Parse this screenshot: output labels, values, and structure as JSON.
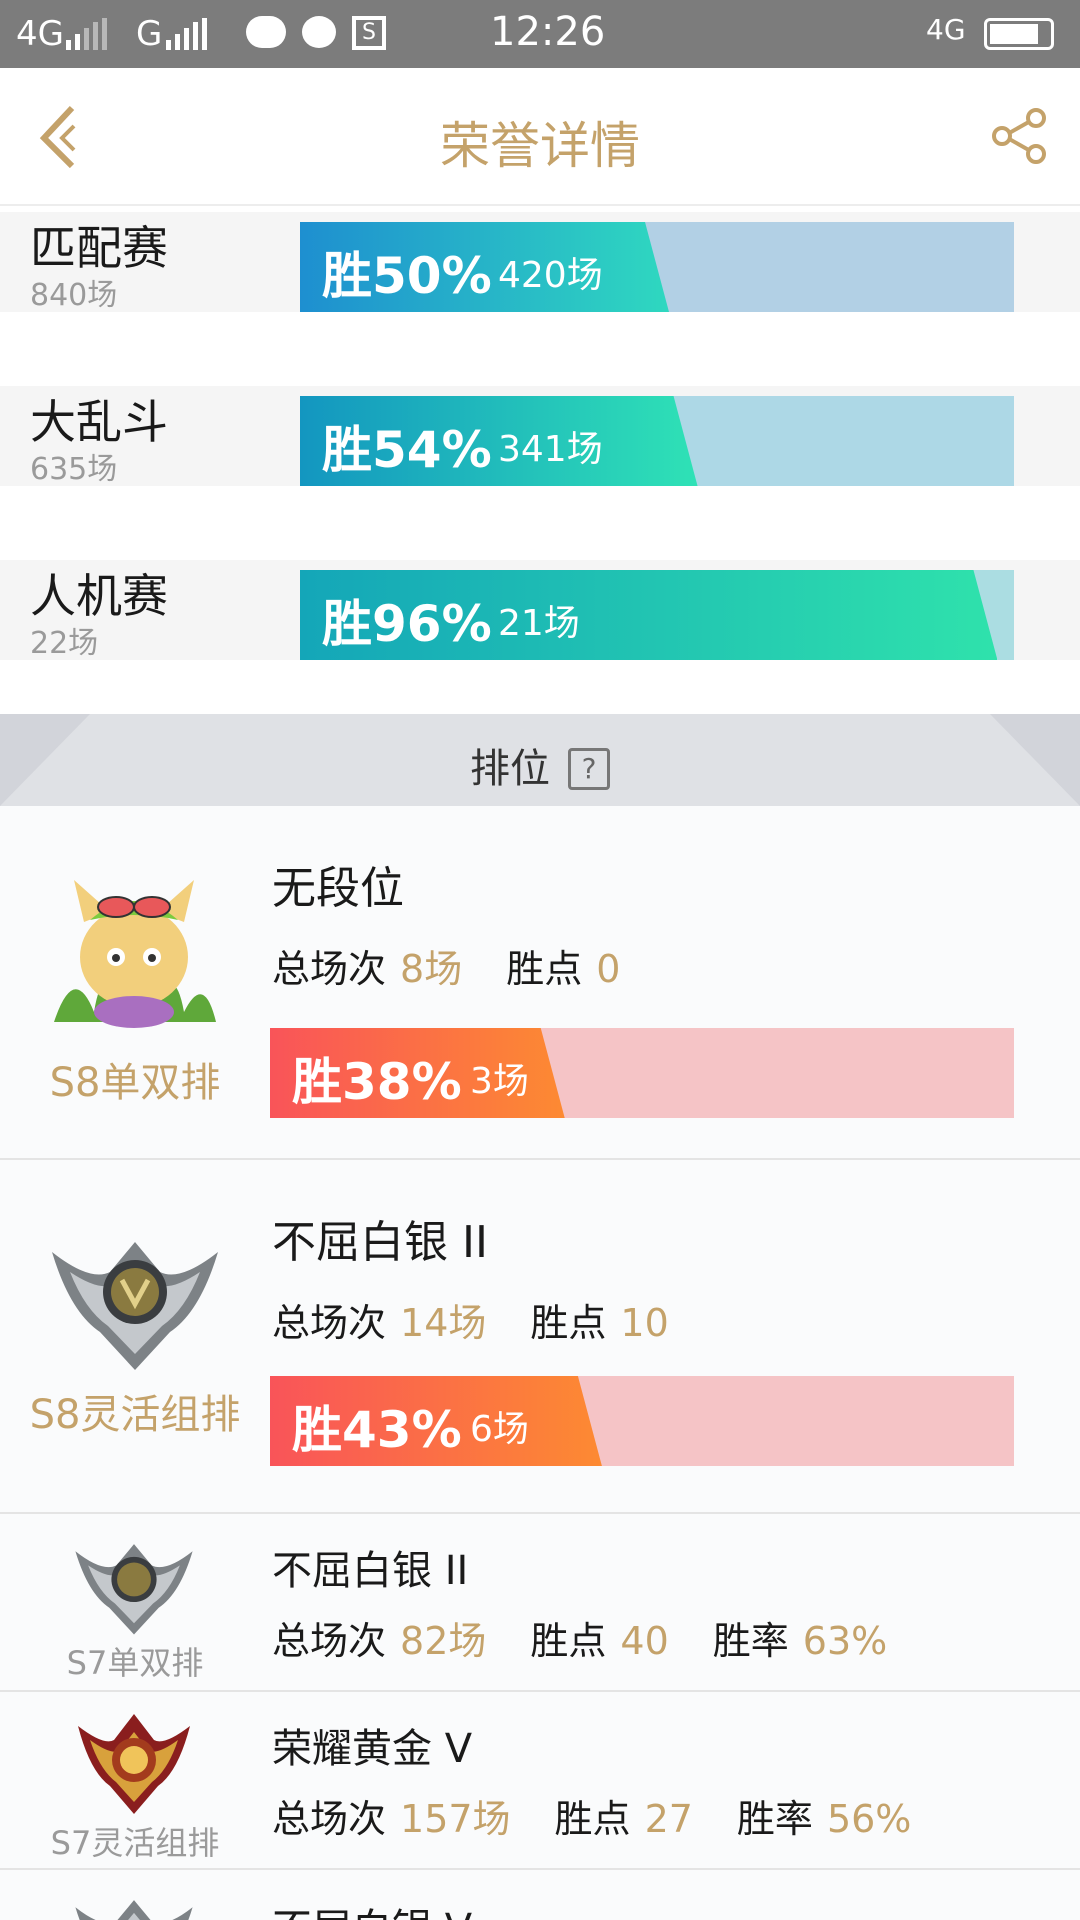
{
  "status_bar": {
    "net1": "4G",
    "net2": "G",
    "time": "12:26",
    "net3": "4G"
  },
  "header": {
    "title": "荣誉详情",
    "back_icon": "chevron-left-icon",
    "share_icon": "share-icon"
  },
  "game_modes": [
    {
      "name": "匹配赛",
      "total": "840场",
      "win_label": "胜50%",
      "wins": "420场",
      "win_fraction": 0.5
    },
    {
      "name": "大乱斗",
      "total": "635场",
      "win_label": "胜54%",
      "wins": "341场",
      "win_fraction": 0.54
    },
    {
      "name": "人机赛",
      "total": "22场",
      "win_label": "胜96%",
      "wins": "21场",
      "win_fraction": 0.96
    }
  ],
  "ranked": {
    "header": "排位",
    "help_icon": "?",
    "entries": [
      {
        "queue": "S8单双排",
        "tier": "无段位",
        "games_label": "总场次",
        "games": "8场",
        "points_label": "胜点",
        "points": "0",
        "win_label": "胜38%",
        "wins": "3场",
        "win_fraction": 0.38,
        "icon": "teemo-avatar-icon"
      },
      {
        "queue": "S8灵活组排",
        "tier": "不屈白银 II",
        "games_label": "总场次",
        "games": "14场",
        "points_label": "胜点",
        "points": "10",
        "win_label": "胜43%",
        "wins": "6场",
        "win_fraction": 0.43,
        "icon": "silver-emblem-icon"
      },
      {
        "queue": "S7单双排",
        "tier": "不屈白银 II",
        "games_label": "总场次",
        "games": "82场",
        "points_label": "胜点",
        "points": "40",
        "rate_label": "胜率",
        "rate": "63%",
        "icon": "silver-emblem-icon"
      },
      {
        "queue": "S7灵活组排",
        "tier": "荣耀黄金 V",
        "games_label": "总场次",
        "games": "157场",
        "points_label": "胜点",
        "points": "27",
        "rate_label": "胜率",
        "rate": "56%",
        "icon": "gold-emblem-icon"
      },
      {
        "tier": "不屈白银 V",
        "icon": "silver-emblem-icon"
      }
    ]
  },
  "colors": {
    "accent": "#c4a26a",
    "win_blue": "#1e8fd0",
    "win_teal": "#2fe2b6",
    "loss_pink": "#f5c4c6",
    "win_red": "#f95459",
    "win_orange": "#fd8a32"
  }
}
